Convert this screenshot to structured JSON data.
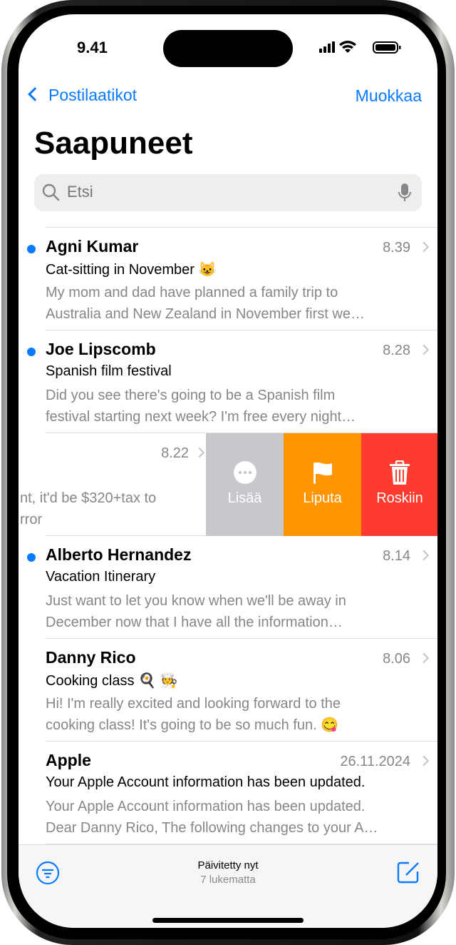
{
  "status": {
    "time": "9.41"
  },
  "nav": {
    "back": "Postilaatikot",
    "edit": "Muokkaa",
    "title": "Saapuneet"
  },
  "search": {
    "placeholder": "Etsi"
  },
  "messages": [
    {
      "sender": "Agni Kumar",
      "time": "8.39",
      "subject": "Cat-sitting in November 😺",
      "preview": [
        "My mom and dad have planned a family trip to",
        "Australia and New Zealand in November first we…"
      ],
      "unread": true
    },
    {
      "sender": "Joe Lipscomb",
      "time": "8.28",
      "subject": "Spanish film festival",
      "preview": [
        "Did you see there's going to be a Spanish film",
        "festival starting next week? I'm free every night…"
      ],
      "unread": true
    },
    {
      "time": "8.22",
      "preview": [
        "nt, it'd be $320+tax to",
        "rror"
      ],
      "swiped": true
    },
    {
      "sender": "Alberto Hernandez",
      "time": "8.14",
      "subject": "Vacation Itinerary",
      "preview": [
        "Just want to let you know when we'll be away in",
        "December now that I have all the information…"
      ],
      "unread": true
    },
    {
      "sender": "Danny Rico",
      "time": "8.06",
      "subject": "Cooking class 🍳 🧑‍🍳",
      "preview": [
        "Hi! I'm really excited and looking forward to the",
        "cooking class! It's going to be so much fun. 😋"
      ],
      "unread": false
    },
    {
      "sender": "Apple",
      "time": "26.11.2024",
      "subject": "Your Apple Account information has been updated.",
      "preview": [
        "Your Apple Account information has been updated.",
        "Dear Danny Rico, The following changes to your A…"
      ],
      "unread": false
    }
  ],
  "swipe_actions": [
    {
      "label": "Lisää",
      "icon": "ellipsis-circle-icon",
      "color": "#c7c7cc"
    },
    {
      "label": "Liputa",
      "icon": "flag-icon",
      "color": "#ff9500"
    },
    {
      "label": "Roskiin",
      "icon": "trash-icon",
      "color": "#ff3b30"
    }
  ],
  "toolbar": {
    "status": "Päivitetty nyt",
    "unread": "7 lukematta"
  },
  "colors": {
    "accent": "#0a7aff",
    "unread_dot": "#0a7aff"
  }
}
